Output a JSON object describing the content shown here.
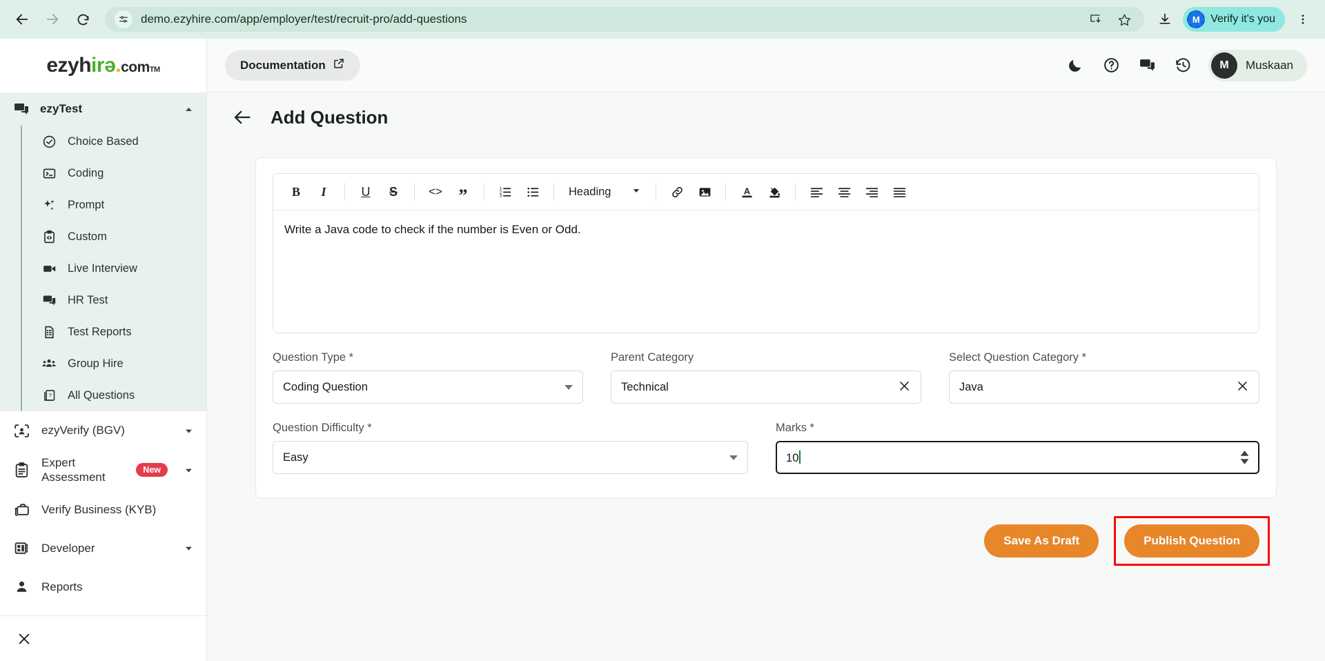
{
  "browser": {
    "back_icon": "back-arrow-icon",
    "forward_icon": "forward-arrow-icon",
    "reload_icon": "reload-icon",
    "site_info_icon": "site-settings-icon",
    "url": "demo.ezyhire.com/app/employer/test/recruit-pro/add-questions",
    "install_icon": "install-app-icon",
    "bookmark_icon": "star-icon",
    "download_icon": "download-icon",
    "verify_label": "Verify it's you",
    "verify_avatar": "M",
    "menu_icon": "three-dot-menu-icon",
    "chrome_bg": "#dff0e8",
    "verify_pill_bg": "#8fe8e0"
  },
  "sidebar": {
    "logo": {
      "part1": "ezyh",
      "part_i": "i",
      "part_r": "r",
      "part_e": "ǝ",
      "dot": ".",
      "com": "com",
      "tm": "TM"
    },
    "group": {
      "label": "ezyTest",
      "icon": "chat-bubbles-icon",
      "expanded_caret": "chevron-up-icon"
    },
    "sub_items": [
      {
        "label": "Choice Based",
        "icon": "check-circle-icon"
      },
      {
        "label": "Coding",
        "icon": "terminal-icon"
      },
      {
        "label": "Prompt",
        "icon": "sparkle-icon"
      },
      {
        "label": "Custom",
        "icon": "clipboard-code-icon"
      },
      {
        "label": "Live Interview",
        "icon": "video-camera-icon"
      },
      {
        "label": "HR Test",
        "icon": "chat-bubbles-icon"
      },
      {
        "label": "Test Reports",
        "icon": "document-report-icon"
      },
      {
        "label": "Group Hire",
        "icon": "people-group-icon"
      },
      {
        "label": "All Questions",
        "icon": "question-pages-icon"
      }
    ],
    "main_items": [
      {
        "label": "ezyVerify (BGV)",
        "icon": "face-scan-icon",
        "caret": true,
        "badge": ""
      },
      {
        "label": "Expert Assessment",
        "icon": "clipboard-list-icon",
        "caret": true,
        "badge": "New"
      },
      {
        "label": "Verify Business (KYB)",
        "icon": "briefcase-icon",
        "caret": false,
        "badge": ""
      },
      {
        "label": "Developer",
        "icon": "dashboard-grid-icon",
        "caret": true,
        "badge": ""
      },
      {
        "label": "Reports",
        "icon": "person-icon",
        "caret": false,
        "badge": ""
      }
    ],
    "close_icon": "close-icon",
    "badge_color": "#e23c4e",
    "group_bg": "#e9f1ee"
  },
  "topbar": {
    "documentation_label": "Documentation",
    "documentation_icon": "external-link-icon",
    "icons": [
      {
        "name": "dark-mode-moon-icon"
      },
      {
        "name": "help-circle-icon"
      },
      {
        "name": "chat-bubbles-icon"
      },
      {
        "name": "history-clock-icon"
      }
    ],
    "user": {
      "initial": "M",
      "name": "Muskaan"
    }
  },
  "page": {
    "back_icon": "back-arrow-icon",
    "title": "Add Question"
  },
  "editor": {
    "toolbar": [
      {
        "name": "bold-icon",
        "glyph": "B"
      },
      {
        "name": "italic-icon",
        "glyph": "I"
      },
      {
        "name": "underline-icon",
        "glyph": "U"
      },
      {
        "name": "strikethrough-icon",
        "glyph": "S"
      },
      {
        "name": "code-icon",
        "glyph": "<>"
      },
      {
        "name": "blockquote-icon",
        "glyph": "”"
      },
      {
        "name": "ordered-list-icon",
        "glyph": ""
      },
      {
        "name": "bullet-list-icon",
        "glyph": ""
      },
      {
        "name": "link-icon",
        "glyph": ""
      },
      {
        "name": "image-icon",
        "glyph": ""
      },
      {
        "name": "text-color-icon",
        "glyph": "A"
      },
      {
        "name": "fill-color-icon",
        "glyph": ""
      },
      {
        "name": "align-left-icon",
        "glyph": ""
      },
      {
        "name": "align-center-icon",
        "glyph": ""
      },
      {
        "name": "align-right-icon",
        "glyph": ""
      },
      {
        "name": "align-justify-icon",
        "glyph": ""
      }
    ],
    "heading_label": "Heading",
    "heading_caret": "chevron-down-icon",
    "content": "Write a Java code to check if the number is Even or Odd."
  },
  "form": {
    "question_type": {
      "label": "Question Type *",
      "value": "Coding Question",
      "control": "dropdown"
    },
    "parent_category": {
      "label": "Parent Category",
      "value": "Technical",
      "control": "clearable",
      "clear_icon": "close-icon"
    },
    "question_category": {
      "label": "Select Question Category *",
      "value": "Java",
      "control": "clearable",
      "clear_icon": "close-icon"
    },
    "question_difficulty": {
      "label": "Question Difficulty *",
      "value": "Easy",
      "control": "dropdown"
    },
    "marks": {
      "label": "Marks *",
      "value": "10",
      "control": "number",
      "focused": true
    }
  },
  "actions": {
    "save_draft_label": "Save As Draft",
    "publish_label": "Publish Question",
    "button_color": "#e8862a",
    "highlight_color": "#ff0000"
  }
}
